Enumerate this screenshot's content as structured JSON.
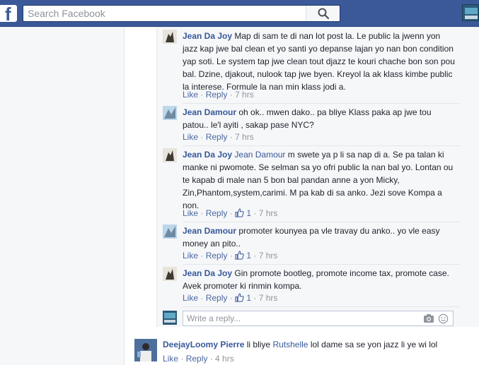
{
  "topbar": {
    "search_placeholder": "Search Facebook",
    "logo_letter": "f"
  },
  "reply_input": {
    "placeholder": "Write a reply..."
  },
  "replies": [
    {
      "author": "Jean Da Joy",
      "mention": "",
      "text": "Map di sam te di nan lot post la. Le public la jwenn yon jazz kap jwe bal clean et yo santi yo depanse lajan yo nan bon condition yap soti. Le system tap jwe clean tout djazz te kouri chache bon son pou bal. Dzine, djakout, nulook tap jwe byen. Kreyol la ak klass kimbe public la interese. Formule la nan min klass jodi a.",
      "like": "Like",
      "reply": "Reply",
      "likes": "",
      "time": "7 hrs"
    },
    {
      "author": "Jean Damour",
      "mention": "",
      "text": "oh ok.. mwen dako.. pa bliye Klass paka ap jwe tou patou.. le'l ayiti , sakap pase NYC?",
      "like": "Like",
      "reply": "Reply",
      "likes": "",
      "time": "7 hrs"
    },
    {
      "author": "Jean Da Joy",
      "mention": "Jean Damour",
      "text": "m swete ya p li sa nap di a. Se pa talan ki manke ni pwomote. Se selman sa yo ofri public la nan bal yo. Lontan ou te kapab di male nan 5 bon bal pandan anne a yon Micky, Zin,Phantom,system,carimi. M pa kab di sa anko. Jezi sove Kompa a non.",
      "like": "Like",
      "reply": "Reply",
      "likes": "1",
      "time": "7 hrs"
    },
    {
      "author": "Jean Damour",
      "mention": "",
      "text": "promoter kounyea pa vle travay du anko.. yo vle easy money an pito..",
      "like": "Like",
      "reply": "Reply",
      "likes": "1",
      "time": "7 hrs"
    },
    {
      "author": "Jean Da Joy",
      "mention": "",
      "text": "Gin promote bootleg, promote income tax, promote case. Avek promoter ki rinmin kompa.",
      "like": "Like",
      "reply": "Reply",
      "likes": "1",
      "time": "7 hrs"
    }
  ],
  "main_comment": {
    "author": "DeejayLoomy Pierre",
    "text_before": "li bliye",
    "mention": "Rutshelle",
    "text_after": "lol dame sa se yon jazz li ye wi lol",
    "like": "Like",
    "reply": "Reply",
    "time": "4 hrs"
  },
  "colors": {
    "brand": "#3b5998",
    "link": "#365899",
    "meta": "#90949c"
  }
}
